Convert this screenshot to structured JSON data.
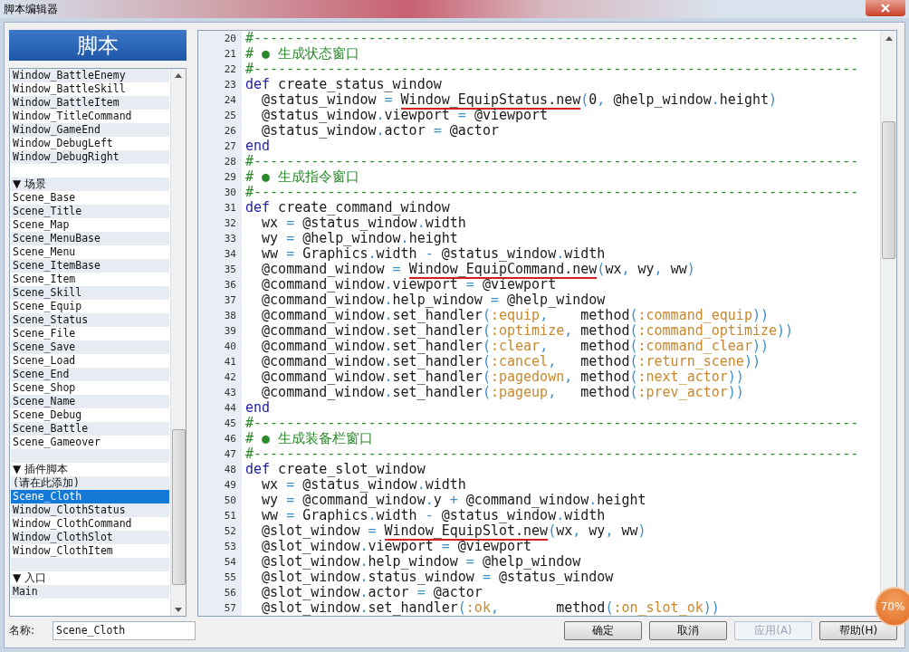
{
  "window": {
    "title": "脚本编辑器"
  },
  "panel_title": "脚本",
  "script_list": [
    {
      "kind": "script",
      "name": "Window_BattleEnemy",
      "selected": false
    },
    {
      "kind": "script",
      "name": "Window_BattleSkill",
      "selected": false
    },
    {
      "kind": "script",
      "name": "Window_BattleItem",
      "selected": false
    },
    {
      "kind": "script",
      "name": "Window_TitleCommand",
      "selected": false
    },
    {
      "kind": "script",
      "name": "Window_GameEnd",
      "selected": false
    },
    {
      "kind": "script",
      "name": "Window_DebugLeft",
      "selected": false
    },
    {
      "kind": "script",
      "name": "Window_DebugRight",
      "selected": false
    },
    {
      "kind": "blank"
    },
    {
      "kind": "section",
      "name": "▼ 场景"
    },
    {
      "kind": "script",
      "name": "Scene_Base",
      "selected": false
    },
    {
      "kind": "script",
      "name": "Scene_Title",
      "selected": false
    },
    {
      "kind": "script",
      "name": "Scene_Map",
      "selected": false
    },
    {
      "kind": "script",
      "name": "Scene_MenuBase",
      "selected": false
    },
    {
      "kind": "script",
      "name": "Scene_Menu",
      "selected": false
    },
    {
      "kind": "script",
      "name": "Scene_ItemBase",
      "selected": false
    },
    {
      "kind": "script",
      "name": "Scene_Item",
      "selected": false
    },
    {
      "kind": "script",
      "name": "Scene_Skill",
      "selected": false
    },
    {
      "kind": "script",
      "name": "Scene_Equip",
      "selected": false
    },
    {
      "kind": "script",
      "name": "Scene_Status",
      "selected": false
    },
    {
      "kind": "script",
      "name": "Scene_File",
      "selected": false
    },
    {
      "kind": "script",
      "name": "Scene_Save",
      "selected": false
    },
    {
      "kind": "script",
      "name": "Scene_Load",
      "selected": false
    },
    {
      "kind": "script",
      "name": "Scene_End",
      "selected": false
    },
    {
      "kind": "script",
      "name": "Scene_Shop",
      "selected": false
    },
    {
      "kind": "script",
      "name": "Scene_Name",
      "selected": false
    },
    {
      "kind": "script",
      "name": "Scene_Debug",
      "selected": false
    },
    {
      "kind": "script",
      "name": "Scene_Battle",
      "selected": false
    },
    {
      "kind": "script",
      "name": "Scene_Gameover",
      "selected": false
    },
    {
      "kind": "blank"
    },
    {
      "kind": "section",
      "name": "▼ 插件脚本"
    },
    {
      "kind": "script",
      "name": "(请在此添加)",
      "selected": false
    },
    {
      "kind": "script",
      "name": "Scene_Cloth",
      "selected": true
    },
    {
      "kind": "script",
      "name": "Window_ClothStatus",
      "selected": false
    },
    {
      "kind": "script",
      "name": "Window_ClothCommand",
      "selected": false
    },
    {
      "kind": "script",
      "name": "Window_ClothSlot",
      "selected": false
    },
    {
      "kind": "script",
      "name": "Window_ClothItem",
      "selected": false
    },
    {
      "kind": "blank"
    },
    {
      "kind": "section",
      "name": "▼ 入口"
    },
    {
      "kind": "script",
      "name": "Main",
      "selected": false
    }
  ],
  "name_field": {
    "label": "名称:",
    "value": "Scene_Cloth"
  },
  "code_lines": [
    {
      "number": "20",
      "tokens": [
        {
          "text": "#--------------------------------------------------------------------------",
          "kind": "cm"
        }
      ]
    },
    {
      "number": "21",
      "tokens": [
        {
          "text": "# ● 生成状态窗口",
          "kind": "cm"
        }
      ]
    },
    {
      "number": "22",
      "tokens": [
        {
          "text": "#--------------------------------------------------------------------------",
          "kind": "cm"
        }
      ]
    },
    {
      "number": "23",
      "tokens": [
        {
          "text": "def",
          "kind": "kw"
        },
        {
          "text": " create_status_window",
          "kind": "id"
        }
      ]
    },
    {
      "number": "24",
      "tokens": [
        {
          "text": "  @status_window",
          "kind": "id"
        },
        {
          "text": " = ",
          "kind": "op"
        },
        {
          "text": "Window_EquipStatus.new",
          "kind": "err"
        },
        {
          "text": "(",
          "kind": "op"
        },
        {
          "text": "0",
          "kind": "id"
        },
        {
          "text": ", ",
          "kind": "op"
        },
        {
          "text": "@help_window",
          "kind": "id"
        },
        {
          "text": ".",
          "kind": "op"
        },
        {
          "text": "height",
          "kind": "id"
        },
        {
          "text": ")",
          "kind": "op"
        }
      ]
    },
    {
      "number": "25",
      "tokens": [
        {
          "text": "  @status_window",
          "kind": "id"
        },
        {
          "text": ".",
          "kind": "op"
        },
        {
          "text": "viewport",
          "kind": "id"
        },
        {
          "text": " = ",
          "kind": "op"
        },
        {
          "text": "@viewport",
          "kind": "id"
        }
      ]
    },
    {
      "number": "26",
      "tokens": [
        {
          "text": "  @status_window",
          "kind": "id"
        },
        {
          "text": ".",
          "kind": "op"
        },
        {
          "text": "actor",
          "kind": "id"
        },
        {
          "text": " = ",
          "kind": "op"
        },
        {
          "text": "@actor",
          "kind": "id"
        }
      ]
    },
    {
      "number": "27",
      "tokens": [
        {
          "text": "end",
          "kind": "kw"
        }
      ]
    },
    {
      "number": "28",
      "tokens": [
        {
          "text": "#--------------------------------------------------------------------------",
          "kind": "cm"
        }
      ]
    },
    {
      "number": "29",
      "tokens": [
        {
          "text": "# ● 生成指令窗口",
          "kind": "cm"
        }
      ]
    },
    {
      "number": "30",
      "tokens": [
        {
          "text": "#--------------------------------------------------------------------------",
          "kind": "cm"
        }
      ]
    },
    {
      "number": "31",
      "tokens": [
        {
          "text": "def",
          "kind": "kw"
        },
        {
          "text": " create_command_window",
          "kind": "id"
        }
      ]
    },
    {
      "number": "32",
      "tokens": [
        {
          "text": "  wx",
          "kind": "id"
        },
        {
          "text": " = ",
          "kind": "op"
        },
        {
          "text": "@status_window",
          "kind": "id"
        },
        {
          "text": ".",
          "kind": "op"
        },
        {
          "text": "width",
          "kind": "id"
        }
      ]
    },
    {
      "number": "33",
      "tokens": [
        {
          "text": "  wy",
          "kind": "id"
        },
        {
          "text": " = ",
          "kind": "op"
        },
        {
          "text": "@help_window",
          "kind": "id"
        },
        {
          "text": ".",
          "kind": "op"
        },
        {
          "text": "height",
          "kind": "id"
        }
      ]
    },
    {
      "number": "34",
      "tokens": [
        {
          "text": "  ww",
          "kind": "id"
        },
        {
          "text": " = ",
          "kind": "op"
        },
        {
          "text": "Graphics",
          "kind": "id"
        },
        {
          "text": ".",
          "kind": "op"
        },
        {
          "text": "width",
          "kind": "id"
        },
        {
          "text": " - ",
          "kind": "op"
        },
        {
          "text": "@status_window",
          "kind": "id"
        },
        {
          "text": ".",
          "kind": "op"
        },
        {
          "text": "width",
          "kind": "id"
        }
      ]
    },
    {
      "number": "35",
      "tokens": [
        {
          "text": "  @command_window",
          "kind": "id"
        },
        {
          "text": " = ",
          "kind": "op"
        },
        {
          "text": "Window_EquipCommand.new",
          "kind": "err"
        },
        {
          "text": "(",
          "kind": "op"
        },
        {
          "text": "wx",
          "kind": "id"
        },
        {
          "text": ", ",
          "kind": "op"
        },
        {
          "text": "wy",
          "kind": "id"
        },
        {
          "text": ", ",
          "kind": "op"
        },
        {
          "text": "ww",
          "kind": "id"
        },
        {
          "text": ")",
          "kind": "op"
        }
      ]
    },
    {
      "number": "36",
      "tokens": [
        {
          "text": "  @command_window",
          "kind": "id"
        },
        {
          "text": ".",
          "kind": "op"
        },
        {
          "text": "viewport",
          "kind": "id"
        },
        {
          "text": " = ",
          "kind": "op"
        },
        {
          "text": "@viewport",
          "kind": "id"
        }
      ]
    },
    {
      "number": "37",
      "tokens": [
        {
          "text": "  @command_window",
          "kind": "id"
        },
        {
          "text": ".",
          "kind": "op"
        },
        {
          "text": "help_window",
          "kind": "id"
        },
        {
          "text": " = ",
          "kind": "op"
        },
        {
          "text": "@help_window",
          "kind": "id"
        }
      ]
    },
    {
      "number": "38",
      "tokens": [
        {
          "text": "  @command_window",
          "kind": "id"
        },
        {
          "text": ".",
          "kind": "op"
        },
        {
          "text": "set_handler",
          "kind": "id"
        },
        {
          "text": "(",
          "kind": "op"
        },
        {
          "text": ":equip",
          "kind": "sym"
        },
        {
          "text": ",    ",
          "kind": "op"
        },
        {
          "text": "method",
          "kind": "id"
        },
        {
          "text": "(",
          "kind": "op"
        },
        {
          "text": ":command_equip",
          "kind": "sym"
        },
        {
          "text": "))",
          "kind": "op"
        }
      ]
    },
    {
      "number": "39",
      "tokens": [
        {
          "text": "  @command_window",
          "kind": "id"
        },
        {
          "text": ".",
          "kind": "op"
        },
        {
          "text": "set_handler",
          "kind": "id"
        },
        {
          "text": "(",
          "kind": "op"
        },
        {
          "text": ":optimize",
          "kind": "sym"
        },
        {
          "text": ", ",
          "kind": "op"
        },
        {
          "text": "method",
          "kind": "id"
        },
        {
          "text": "(",
          "kind": "op"
        },
        {
          "text": ":command_optimize",
          "kind": "sym"
        },
        {
          "text": "))",
          "kind": "op"
        }
      ]
    },
    {
      "number": "40",
      "tokens": [
        {
          "text": "  @command_window",
          "kind": "id"
        },
        {
          "text": ".",
          "kind": "op"
        },
        {
          "text": "set_handler",
          "kind": "id"
        },
        {
          "text": "(",
          "kind": "op"
        },
        {
          "text": ":clear",
          "kind": "sym"
        },
        {
          "text": ",    ",
          "kind": "op"
        },
        {
          "text": "method",
          "kind": "id"
        },
        {
          "text": "(",
          "kind": "op"
        },
        {
          "text": ":command_clear",
          "kind": "sym"
        },
        {
          "text": "))",
          "kind": "op"
        }
      ]
    },
    {
      "number": "41",
      "tokens": [
        {
          "text": "  @command_window",
          "kind": "id"
        },
        {
          "text": ".",
          "kind": "op"
        },
        {
          "text": "set_handler",
          "kind": "id"
        },
        {
          "text": "(",
          "kind": "op"
        },
        {
          "text": ":cancel",
          "kind": "sym"
        },
        {
          "text": ",   ",
          "kind": "op"
        },
        {
          "text": "method",
          "kind": "id"
        },
        {
          "text": "(",
          "kind": "op"
        },
        {
          "text": ":return_scene",
          "kind": "sym"
        },
        {
          "text": "))",
          "kind": "op"
        }
      ]
    },
    {
      "number": "42",
      "tokens": [
        {
          "text": "  @command_window",
          "kind": "id"
        },
        {
          "text": ".",
          "kind": "op"
        },
        {
          "text": "set_handler",
          "kind": "id"
        },
        {
          "text": "(",
          "kind": "op"
        },
        {
          "text": ":pagedown",
          "kind": "sym"
        },
        {
          "text": ", ",
          "kind": "op"
        },
        {
          "text": "method",
          "kind": "id"
        },
        {
          "text": "(",
          "kind": "op"
        },
        {
          "text": ":next_actor",
          "kind": "sym"
        },
        {
          "text": "))",
          "kind": "op"
        }
      ]
    },
    {
      "number": "43",
      "tokens": [
        {
          "text": "  @command_window",
          "kind": "id"
        },
        {
          "text": ".",
          "kind": "op"
        },
        {
          "text": "set_handler",
          "kind": "id"
        },
        {
          "text": "(",
          "kind": "op"
        },
        {
          "text": ":pageup",
          "kind": "sym"
        },
        {
          "text": ",   ",
          "kind": "op"
        },
        {
          "text": "method",
          "kind": "id"
        },
        {
          "text": "(",
          "kind": "op"
        },
        {
          "text": ":prev_actor",
          "kind": "sym"
        },
        {
          "text": "))",
          "kind": "op"
        }
      ]
    },
    {
      "number": "44",
      "tokens": [
        {
          "text": "end",
          "kind": "kw"
        }
      ]
    },
    {
      "number": "45",
      "tokens": [
        {
          "text": "#--------------------------------------------------------------------------",
          "kind": "cm"
        }
      ]
    },
    {
      "number": "46",
      "tokens": [
        {
          "text": "# ● 生成装备栏窗口",
          "kind": "cm"
        }
      ]
    },
    {
      "number": "47",
      "tokens": [
        {
          "text": "#--------------------------------------------------------------------------",
          "kind": "cm"
        }
      ]
    },
    {
      "number": "48",
      "tokens": [
        {
          "text": "def",
          "kind": "kw"
        },
        {
          "text": " create_slot_window",
          "kind": "id"
        }
      ]
    },
    {
      "number": "49",
      "tokens": [
        {
          "text": "  wx",
          "kind": "id"
        },
        {
          "text": " = ",
          "kind": "op"
        },
        {
          "text": "@status_window",
          "kind": "id"
        },
        {
          "text": ".",
          "kind": "op"
        },
        {
          "text": "width",
          "kind": "id"
        }
      ]
    },
    {
      "number": "50",
      "tokens": [
        {
          "text": "  wy",
          "kind": "id"
        },
        {
          "text": " = ",
          "kind": "op"
        },
        {
          "text": "@command_window",
          "kind": "id"
        },
        {
          "text": ".",
          "kind": "op"
        },
        {
          "text": "y",
          "kind": "id"
        },
        {
          "text": " + ",
          "kind": "op"
        },
        {
          "text": "@command_window",
          "kind": "id"
        },
        {
          "text": ".",
          "kind": "op"
        },
        {
          "text": "height",
          "kind": "id"
        }
      ]
    },
    {
      "number": "51",
      "tokens": [
        {
          "text": "  ww",
          "kind": "id"
        },
        {
          "text": " = ",
          "kind": "op"
        },
        {
          "text": "Graphics",
          "kind": "id"
        },
        {
          "text": ".",
          "kind": "op"
        },
        {
          "text": "width",
          "kind": "id"
        },
        {
          "text": " - ",
          "kind": "op"
        },
        {
          "text": "@status_window",
          "kind": "id"
        },
        {
          "text": ".",
          "kind": "op"
        },
        {
          "text": "width",
          "kind": "id"
        }
      ]
    },
    {
      "number": "52",
      "tokens": [
        {
          "text": "  @slot_window",
          "kind": "id"
        },
        {
          "text": " = ",
          "kind": "op"
        },
        {
          "text": "Window_EquipSlot.new",
          "kind": "err"
        },
        {
          "text": "(",
          "kind": "op"
        },
        {
          "text": "wx",
          "kind": "id"
        },
        {
          "text": ", ",
          "kind": "op"
        },
        {
          "text": "wy",
          "kind": "id"
        },
        {
          "text": ", ",
          "kind": "op"
        },
        {
          "text": "ww",
          "kind": "id"
        },
        {
          "text": ")",
          "kind": "op"
        }
      ]
    },
    {
      "number": "53",
      "tokens": [
        {
          "text": "  @slot_window",
          "kind": "id"
        },
        {
          "text": ".",
          "kind": "op"
        },
        {
          "text": "viewport",
          "kind": "id"
        },
        {
          "text": " = ",
          "kind": "op"
        },
        {
          "text": "@viewport",
          "kind": "id"
        }
      ]
    },
    {
      "number": "54",
      "tokens": [
        {
          "text": "  @slot_window",
          "kind": "id"
        },
        {
          "text": ".",
          "kind": "op"
        },
        {
          "text": "help_window",
          "kind": "id"
        },
        {
          "text": " = ",
          "kind": "op"
        },
        {
          "text": "@help_window",
          "kind": "id"
        }
      ]
    },
    {
      "number": "55",
      "tokens": [
        {
          "text": "  @slot_window",
          "kind": "id"
        },
        {
          "text": ".",
          "kind": "op"
        },
        {
          "text": "status_window",
          "kind": "id"
        },
        {
          "text": " = ",
          "kind": "op"
        },
        {
          "text": "@status_window",
          "kind": "id"
        }
      ]
    },
    {
      "number": "56",
      "tokens": [
        {
          "text": "  @slot_window",
          "kind": "id"
        },
        {
          "text": ".",
          "kind": "op"
        },
        {
          "text": "actor",
          "kind": "id"
        },
        {
          "text": " = ",
          "kind": "op"
        },
        {
          "text": "@actor",
          "kind": "id"
        }
      ]
    },
    {
      "number": "57",
      "tokens": [
        {
          "text": "  @slot_window",
          "kind": "id"
        },
        {
          "text": ".",
          "kind": "op"
        },
        {
          "text": "set_handler",
          "kind": "id"
        },
        {
          "text": "(",
          "kind": "op"
        },
        {
          "text": ":ok",
          "kind": "sym"
        },
        {
          "text": ",       ",
          "kind": "op"
        },
        {
          "text": "method",
          "kind": "id"
        },
        {
          "text": "(",
          "kind": "op"
        },
        {
          "text": ":on_slot_ok",
          "kind": "sym"
        },
        {
          "text": "))",
          "kind": "op"
        }
      ]
    }
  ],
  "buttons": [
    {
      "label": "确定",
      "disabled": false
    },
    {
      "label": "取消",
      "disabled": false
    },
    {
      "label": "应用(A)",
      "disabled": true
    },
    {
      "label": "帮助(H)",
      "disabled": false
    }
  ],
  "speed_badge": {
    "text": "70%"
  }
}
